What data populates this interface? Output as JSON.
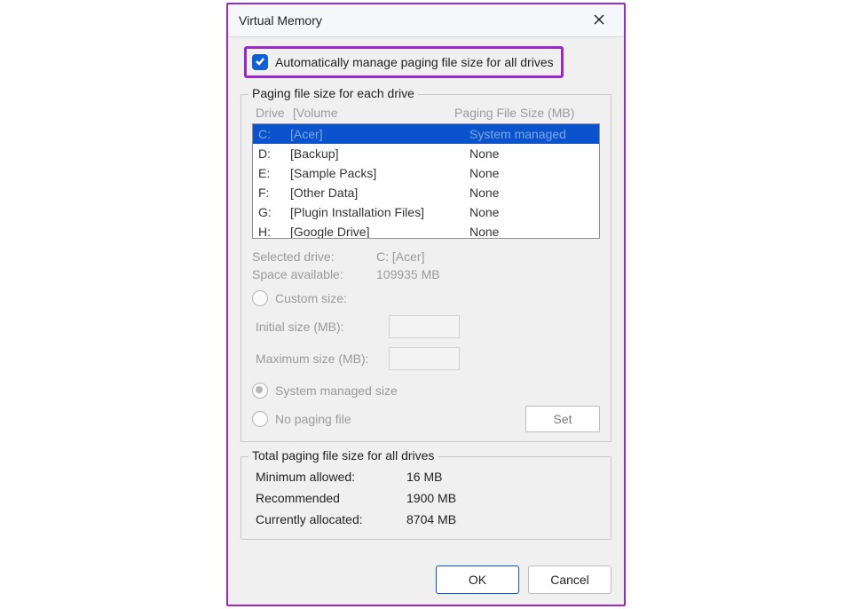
{
  "window": {
    "title": "Virtual Memory"
  },
  "auto_manage": {
    "label": "Automatically manage paging file size for all drives",
    "checked": true
  },
  "group1": {
    "legend": "Paging file size for each drive",
    "headers": {
      "drive": "Drive",
      "volume": "[Volume",
      "size": "Paging File Size (MB)"
    },
    "drives": [
      {
        "letter": "C:",
        "volume": "[Acer]",
        "size": "System managed",
        "selected": true
      },
      {
        "letter": "D:",
        "volume": "[Backup]",
        "size": "None"
      },
      {
        "letter": "E:",
        "volume": "[Sample Packs]",
        "size": "None"
      },
      {
        "letter": "F:",
        "volume": "[Other Data]",
        "size": "None"
      },
      {
        "letter": "G:",
        "volume": "[Plugin Installation Files]",
        "size": "None"
      },
      {
        "letter": "H:",
        "volume": "[Google Drive]",
        "size": "None"
      }
    ],
    "selected_drive_label": "Selected drive:",
    "selected_drive_value": "C:  [Acer]",
    "space_label": "Space available:",
    "space_value": "109935 MB",
    "custom_size_label": "Custom size:",
    "initial_label": "Initial size (MB):",
    "max_label": "Maximum size (MB):",
    "system_managed_label": "System managed size",
    "no_paging_label": "No paging file",
    "set_button": "Set"
  },
  "totals": {
    "legend": "Total paging file size for all drives",
    "min_label": "Minimum allowed:",
    "min_value": "16 MB",
    "rec_label": "Recommended",
    "rec_value": "1900 MB",
    "cur_label": "Currently allocated:",
    "cur_value": "8704 MB"
  },
  "footer": {
    "ok": "OK",
    "cancel": "Cancel"
  }
}
